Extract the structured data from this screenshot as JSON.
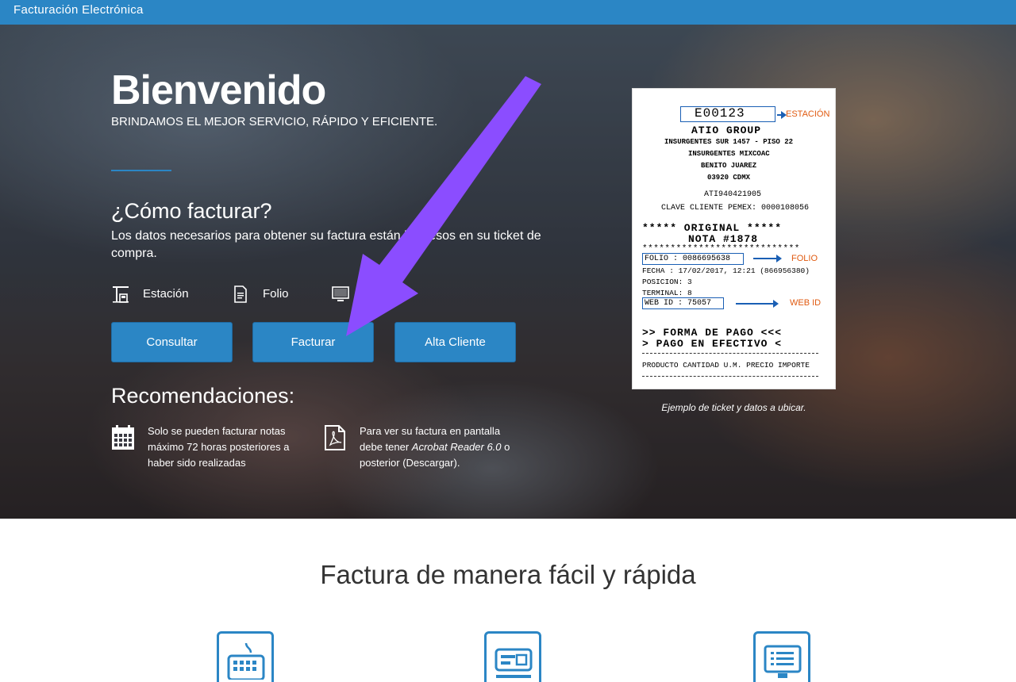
{
  "topbar": {
    "brand": "Facturación Electrónica"
  },
  "hero": {
    "title": "Bienvenido",
    "subtitle": "BRINDAMOS EL MEJOR SERVICIO, RÁPIDO Y EFICIENTE.",
    "how_title": "¿Cómo facturar?",
    "how_desc": "Los datos necesarios para obtener su factura están impresos en su ticket de compra.",
    "requirements": [
      {
        "label": "Estación",
        "icon": "gas-station-icon"
      },
      {
        "label": "Folio",
        "icon": "document-icon"
      },
      {
        "label": "Web ID",
        "icon": "monitor-icon"
      }
    ],
    "buttons": {
      "consultar": "Consultar",
      "facturar": "Facturar",
      "alta_cliente": "Alta Cliente"
    },
    "reco_title": "Recomendaciones:",
    "recommendations": {
      "r1_line1": "Solo se pueden facturar notas",
      "r1_line2": "máximo 72 horas posteriores a",
      "r1_line3": "haber sido realizadas",
      "r2_line1": "Para ver su factura en pantalla",
      "r2_line2_pre": "debe tener ",
      "r2_line2_em": "Acrobat Reader 6.0",
      "r2_line2_post": " o",
      "r2_line3": "posterior (Descargar)."
    }
  },
  "ticket": {
    "station_code": "E00123",
    "station_tag": "ESTACIÓN",
    "company": "ATIO GROUP",
    "address1": "INSURGENTES SUR 1457 - PISO 22",
    "address2": "INSURGENTES MIXCOAC",
    "address3": "BENITO JUAREZ",
    "address4": "03920 CDMX",
    "rfc": "ATI940421905",
    "client_key": "CLAVE CLIENTE PEMEX: 0000108056",
    "original": "***** ORIGINAL *****",
    "nota": "NOTA #1878",
    "stars": "****************************",
    "folio": "FOLIO   : 0086695638",
    "folio_tag": "FOLIO",
    "fecha": "FECHA   : 17/02/2017, 12:21 (866956380)",
    "posicion": "POSICION: 3",
    "terminal": "TERMINAL: 8",
    "webid": "WEB ID  : 75057",
    "webid_tag": "WEB ID",
    "forma_pago": ">> FORMA DE PAGO <<<",
    "pago_efectivo": "> PAGO EN EFECTIVO <",
    "columns": "PRODUCTO CANTIDAD U.M. PRECIO   IMPORTE",
    "caption": "Ejemplo de ticket y datos a ubicar."
  },
  "lower": {
    "title": "Factura de manera fácil y rápida",
    "features": [
      "keyboard-icon",
      "card-icon",
      "monitor-list-icon"
    ]
  },
  "colors": {
    "primary": "#2b86c5",
    "annotation_arrow": "#8b4dff",
    "ticket_tag": "#e05a10"
  }
}
